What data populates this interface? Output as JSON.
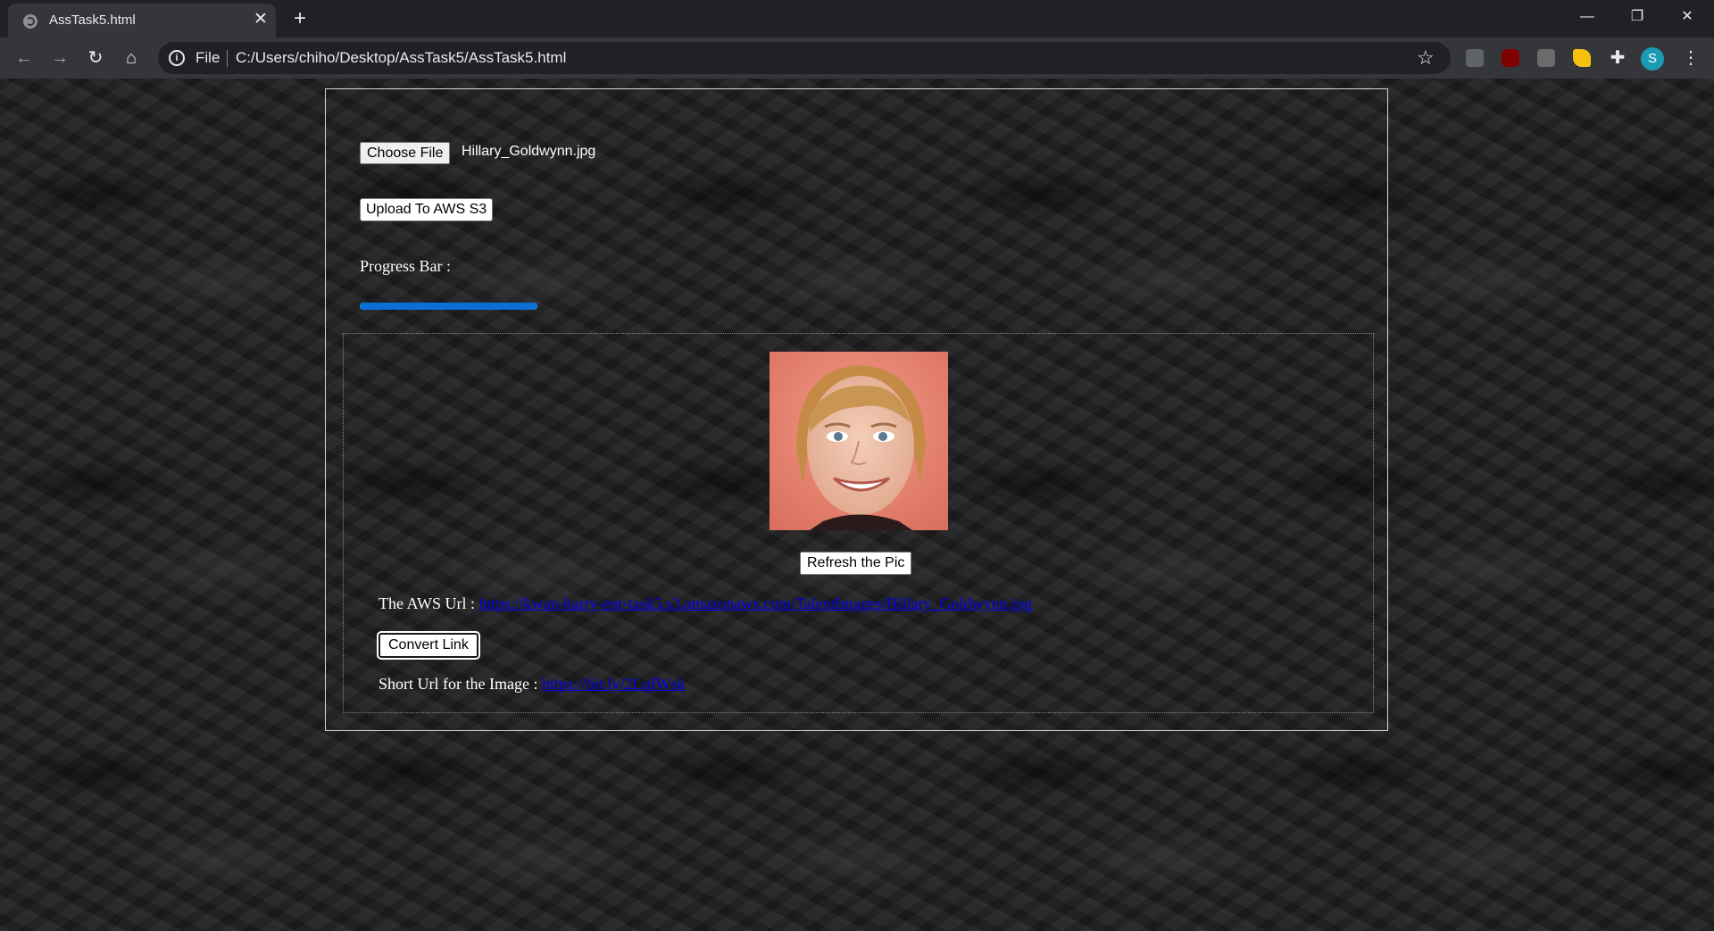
{
  "browser": {
    "tab_title": "AssTask5.html",
    "tab_close": "✕",
    "new_tab": "+",
    "window": {
      "minimize": "—",
      "restore": "❐",
      "close": "✕"
    },
    "nav": {
      "back": "←",
      "forward": "→",
      "reload": "↻",
      "home": "⌂"
    },
    "omnibox": {
      "scheme_label": "File",
      "url": "C:/Users/chiho/Desktop/AssTask5/AssTask5.html"
    },
    "profile_initial": "S",
    "extensions": [
      "pdf-extension-icon",
      "ublock-icon",
      "extension-icon",
      "feedback-extension-icon",
      "puzzle-icon"
    ],
    "accent_color": "#1a9bb3"
  },
  "page": {
    "choose_file_label": "Choose File",
    "file_name": "Hillary_Goldwynn.jpg",
    "upload_label": "Upload To AWS S3",
    "progress_label": "Progress Bar :",
    "progress_value": 100,
    "progress_color": "#0a6fd6",
    "refresh_label": "Refresh the Pic",
    "aws_label": "The AWS Url :",
    "aws_url": "https://kwan-harry-ent-task5.s3.amazonaws.com/TalentImages/Hillary_Goldwynn.jpg",
    "convert_label": "Convert Link",
    "short_label": "Short Url for the Image :",
    "short_url": "https://bit.ly/2LqIWsk"
  }
}
